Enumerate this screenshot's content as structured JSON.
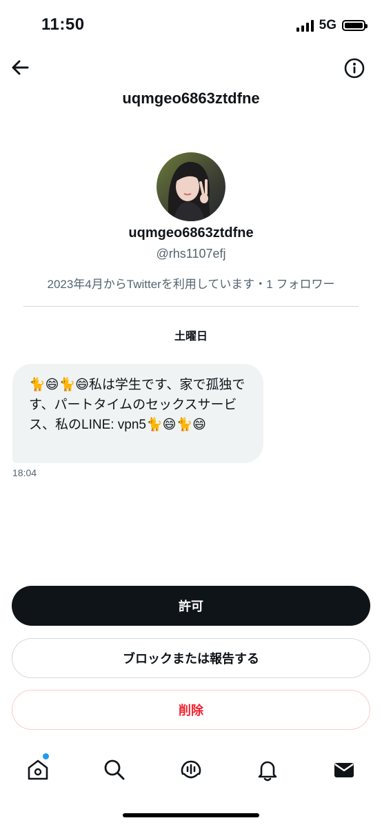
{
  "status_bar": {
    "time": "11:50",
    "network": "5G",
    "battery_level_percent": 100
  },
  "header": {
    "title": "uqmgeo6863ztdfne",
    "back_icon": "arrow-left-icon",
    "info_icon": "info-icon"
  },
  "profile": {
    "display_name": "uqmgeo6863ztdfne",
    "handle": "@rhs1107efj",
    "joined_info": "2023年4月からTwitterを利用しています・1 フォロワー"
  },
  "conversation": {
    "day_label": "土曜日",
    "message": {
      "text": "🐈😄🐈😄私は学生です、家で孤独です、パートタイムのセックスサービス、私のLINE: vpn5🐈😄🐈😄",
      "time": "18:04"
    }
  },
  "actions": {
    "allow_label": "許可",
    "block_report_label": "ブロックまたは報告する",
    "delete_label": "削除"
  },
  "tab_bar": {
    "items": [
      "home-icon",
      "search-icon",
      "spaces-icon",
      "notifications-icon",
      "messages-icon"
    ],
    "home_has_notification_dot": true
  },
  "colors": {
    "accent": "#1d9bf0",
    "delete_red": "#f4212e",
    "primary_text": "#0f1419",
    "secondary_text": "#536471"
  }
}
